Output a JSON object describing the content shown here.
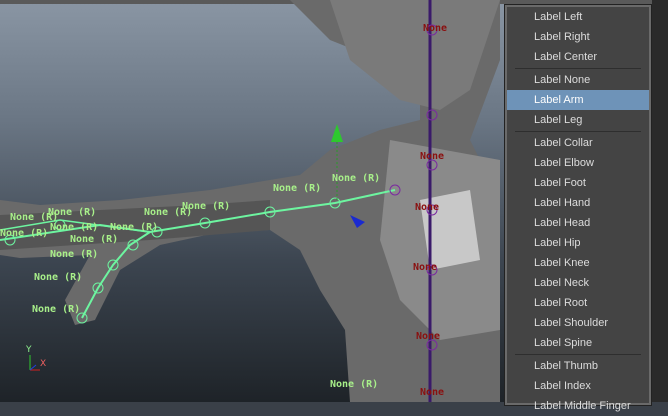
{
  "menu": {
    "items": [
      {
        "label": "Label Left"
      },
      {
        "label": "Label Right"
      },
      {
        "label": "Label Center"
      },
      {
        "label": "Label None"
      },
      {
        "label": "Label Arm",
        "highlighted": true
      },
      {
        "label": "Label Leg"
      },
      {
        "label": "Label Collar"
      },
      {
        "label": "Label Elbow"
      },
      {
        "label": "Label Foot"
      },
      {
        "label": "Label Hand"
      },
      {
        "label": "Label Head"
      },
      {
        "label": "Label Hip"
      },
      {
        "label": "Label Knee"
      },
      {
        "label": "Label Neck"
      },
      {
        "label": "Label Root"
      },
      {
        "label": "Label Shoulder"
      },
      {
        "label": "Label Spine"
      },
      {
        "label": "Label Thumb"
      },
      {
        "label": "Label Index"
      },
      {
        "label": "Label Middle Finger"
      }
    ]
  },
  "joint_label_arm": "None (R)",
  "joint_label_spine": "None",
  "axis": {
    "y": "Y",
    "x": "X"
  },
  "colors": {
    "highlight": "#6e93b8",
    "joint_green": "#a8f08a",
    "spine_label": "#8a1010"
  }
}
